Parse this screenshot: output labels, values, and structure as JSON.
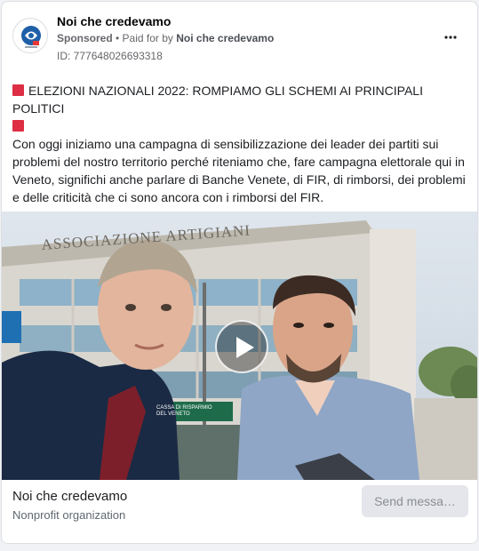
{
  "ad": {
    "page_name": "Noi che credevamo",
    "sponsored_label": "Sponsored",
    "separator": " • ",
    "paid_for_prefix": "Paid for by ",
    "paid_for_by": "Noi che credevamo",
    "ad_id": "ID: 777648026693318",
    "more_options_icon": "more-horizontal-icon"
  },
  "body": {
    "headline": "ELEZIONI NAZIONALI 2022: ROMPIAMO GLI SCHEMI AI PRINCIPALI POLITICI",
    "paragraph": "Con oggi iniziamo una campagna di sensibilizzazione dei leader dei partiti sui problemi del nostro territorio perché riteniamo che, fare campagna elettorale qui in Veneto, significhi anche parlare di Banche Venete, di FIR, di rimborsi, dei problemi e delle criticità che ci sono ancora con i rimborsi del FIR.",
    "truncation": "…",
    "emoji": "red-square-icon",
    "emoji_color": "#dd2e44"
  },
  "media": {
    "type": "video",
    "building_sign": "ASSOCIAZIONE ARTIGIANI",
    "bank_sign_line1": "CASSA DI RISPARMIO",
    "bank_sign_line2": "DEL VENETO",
    "play_icon": "play-icon"
  },
  "footer": {
    "page_name": "Noi che credevamo",
    "category": "Nonprofit organization",
    "cta_label": "Send messa…"
  }
}
